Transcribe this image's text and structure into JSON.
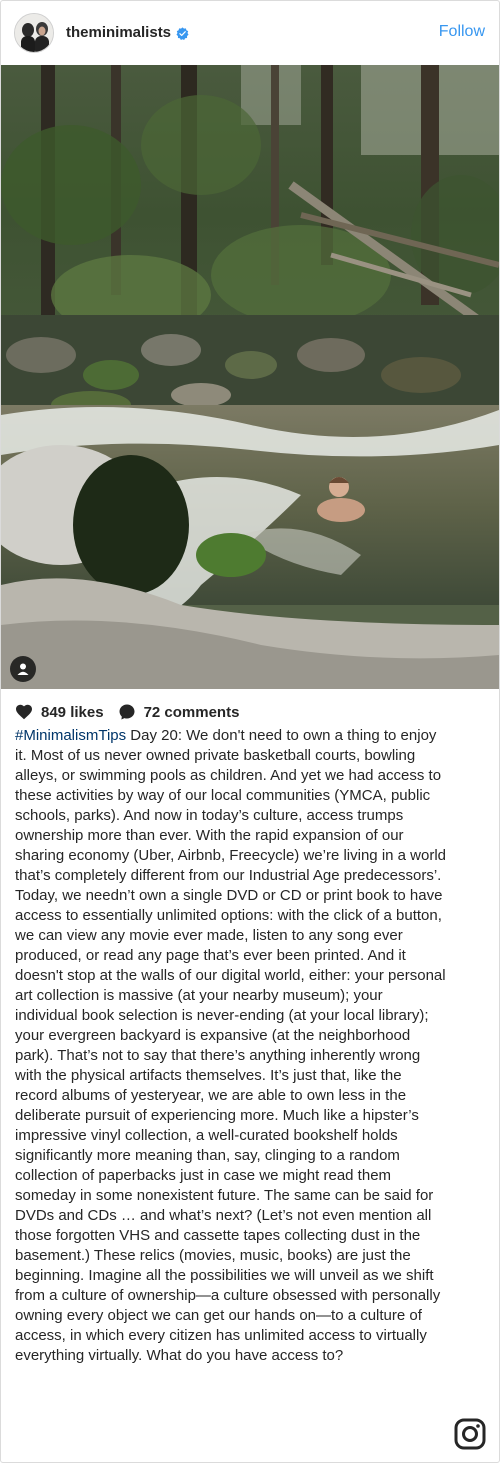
{
  "header": {
    "username": "theminimalists",
    "follow_label": "Follow",
    "verified_icon": "verified-badge-icon",
    "accent_color": "#3897f0"
  },
  "post": {
    "likes_text": "849 likes",
    "comments_text": "72 comments"
  },
  "caption": {
    "hashtag": "#MinimalismTips",
    "text": " Day 20: We don't need to own a thing to enjoy it. Most of us never owned private basketball courts, bowling alleys, or swimming pools as children. And yet we had access to these activities by way of our local communities (YMCA, public schools, parks). And now in today’s culture, access trumps ownership more than ever. With the rapid expansion of our sharing economy (Uber, Airbnb, Freecycle) we’re living in a world that’s completely different from our Industrial Age predecessors’. Today, we needn’t own a single DVD or CD or print book to have access to essentially unlimited options: with the click of a button, we can view any movie ever made, listen to any song ever produced, or read any page that’s ever been printed. And it doesn't stop at the walls of our digital world, either: your personal art collection is massive (at your nearby museum); your individual book selection is never-ending (at your local library); your evergreen backyard is expansive (at the neighborhood park). That’s not to say that there’s anything inherently wrong with the physical artifacts themselves. It’s just that, like the record albums of yesteryear, we are able to own less in the deliberate pursuit of experiencing more. Much like a hipster’s impressive vinyl collection, a well-curated bookshelf holds significantly more meaning than, say, clinging to a random collection of paperbacks just in case we might read them someday in some nonexistent future. The same can be said for DVDs and CDs … and what’s next? (Let’s not even mention all those forgotten VHS and cassette tapes collecting dust in the basement.) These relics (movies, music, books) are just the beginning. Imagine all the possibilities we will unveil as we shift from a culture of ownership—a culture obsessed with personally owning every object we can get our hands on—to a culture of access, in which every citizen has unlimited access to virtually everything virtually. What do you have access to?",
    "hashtag_color": "#003569"
  },
  "icons": {
    "heart": "heart-icon",
    "comment": "comment-bubble-icon",
    "user_tag": "user-tag-icon",
    "instagram": "instagram-logo-icon"
  }
}
